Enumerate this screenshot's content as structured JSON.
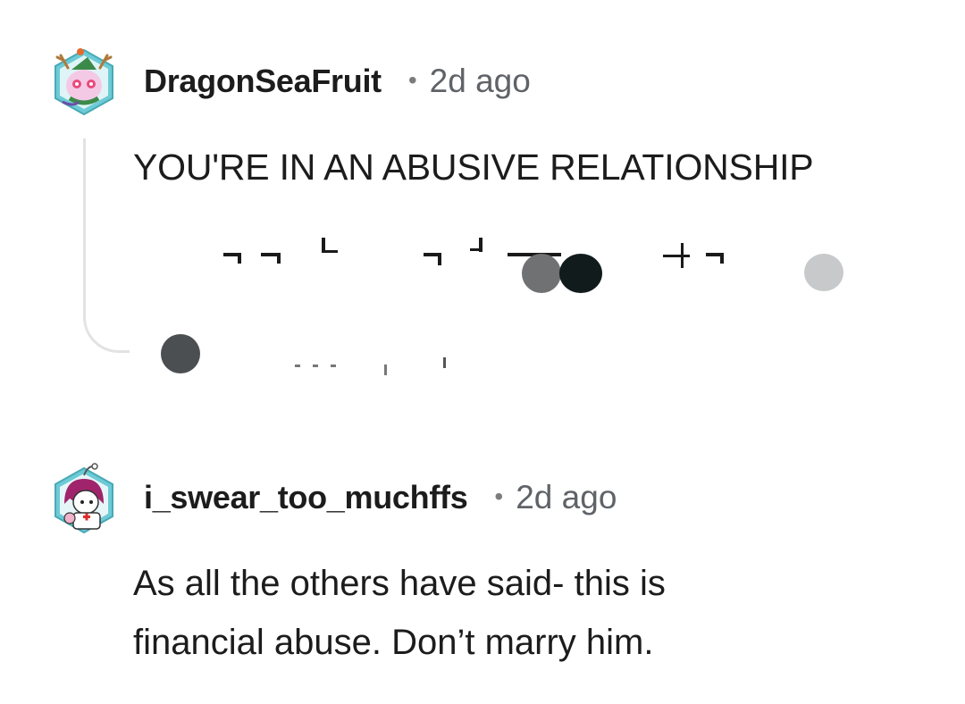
{
  "comments": [
    {
      "username": "DragonSeaFruit",
      "separator": "•",
      "time": "2d ago",
      "text": "YOU'RE IN AN ABUSIVE RELATIONSHIP",
      "avatar_icon": "deer-creature-avatar-icon"
    },
    {
      "username": "i_swear_too_muchffs",
      "separator": "•",
      "time": "2d ago",
      "text_lines": [
        "As all the others have said- this is",
        "financial abuse. Don’t marry him."
      ],
      "avatar_icon": "nurse-character-avatar-icon"
    }
  ],
  "colors": {
    "username": "#1c1c1c",
    "meta": "#5f6368",
    "thread_line": "#e3e3e3",
    "avatar_hex": "#7fd3dd"
  }
}
